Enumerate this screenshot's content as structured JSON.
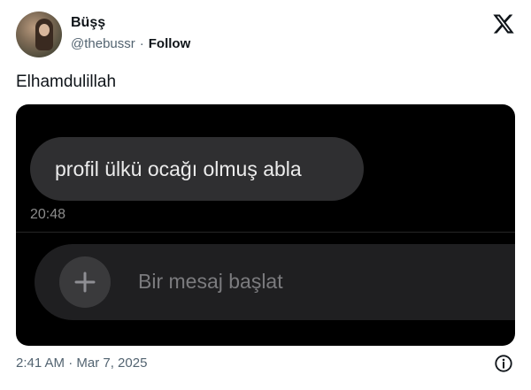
{
  "author": {
    "name": "Büşş",
    "handle": "@thebussr",
    "separator": "·",
    "follow_label": "Follow"
  },
  "tweet": {
    "text": "Elhamdulillah",
    "timestamp": "2:41 AM · Mar 7, 2025"
  },
  "screenshot": {
    "message_text": "profil ülkü ocağı olmuş abla",
    "message_time": "20:48",
    "compose_placeholder": "Bir mesaj başlat"
  },
  "icons": {
    "platform_logo": "x-logo-icon",
    "add": "plus-icon",
    "info": "info-icon"
  },
  "colors": {
    "text_primary": "#0f1419",
    "text_secondary": "#536471",
    "media_background": "#000000",
    "bubble": "#2f2f31",
    "compose_bar": "#1f1f21"
  }
}
